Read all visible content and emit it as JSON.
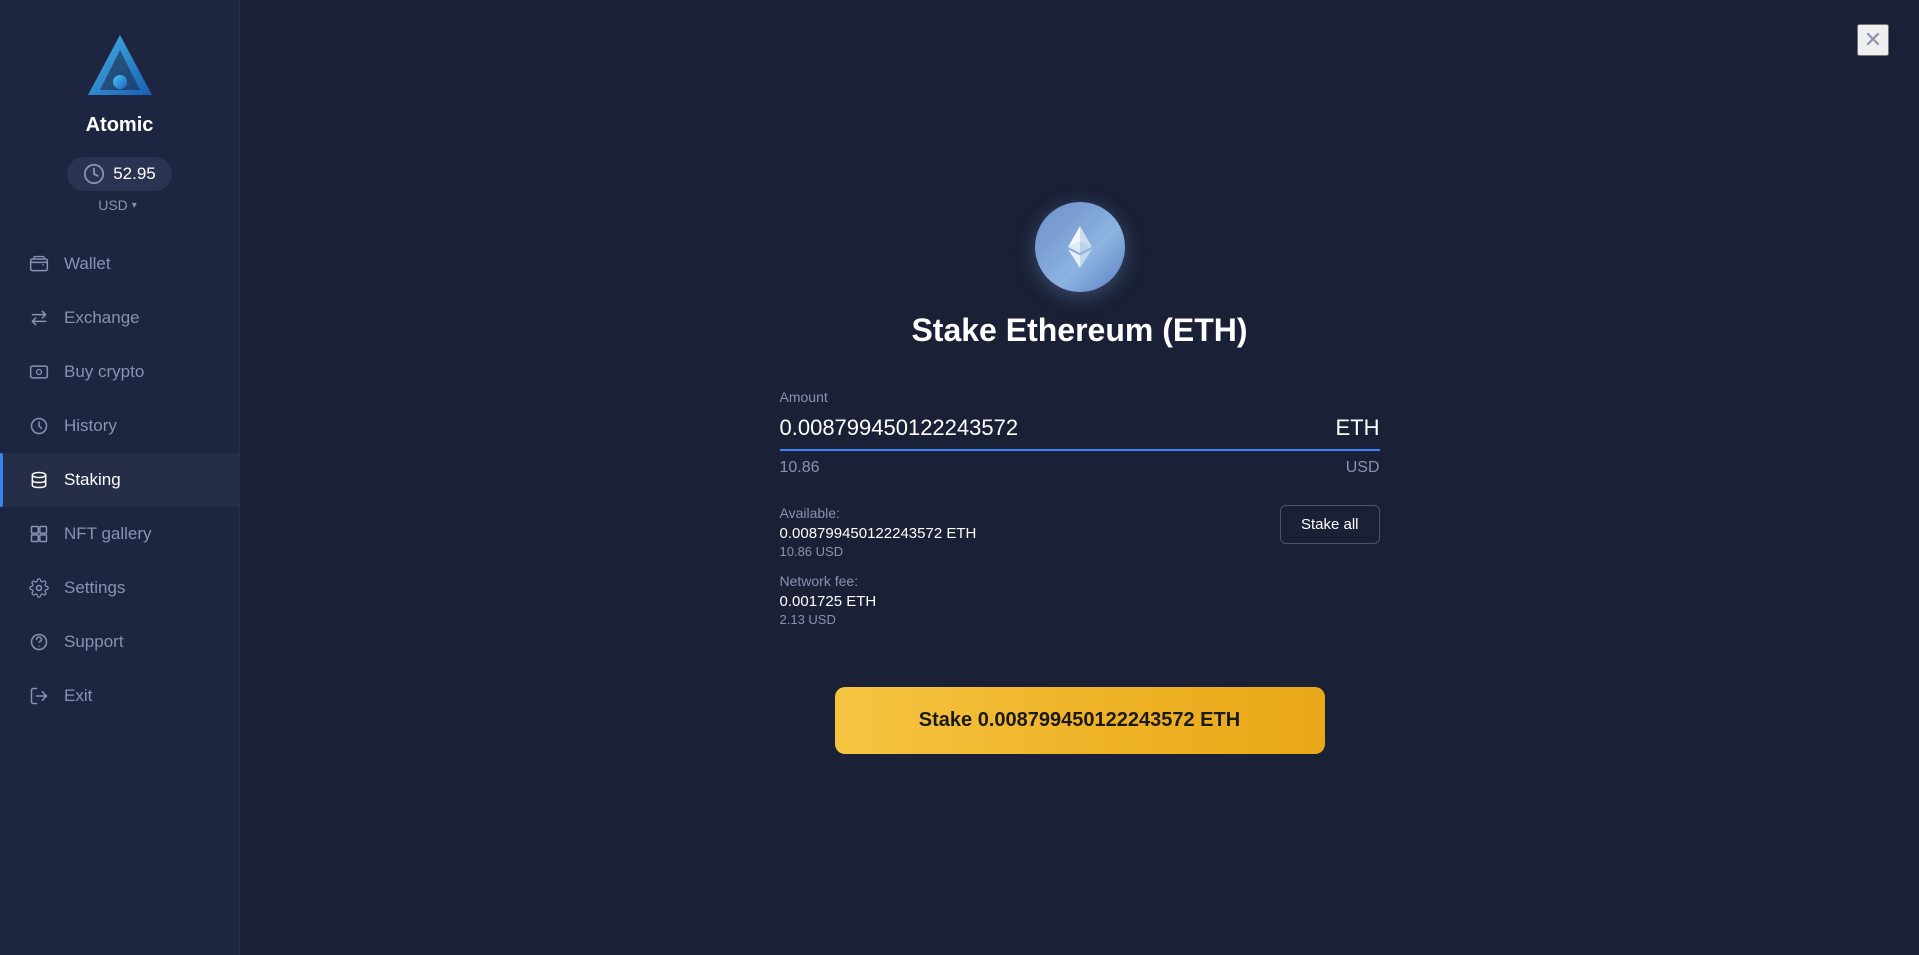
{
  "app": {
    "name": "Atomic",
    "balance": "52.95",
    "currency": "USD"
  },
  "sidebar": {
    "items": [
      {
        "id": "wallet",
        "label": "Wallet",
        "icon": "wallet-icon",
        "active": false
      },
      {
        "id": "exchange",
        "label": "Exchange",
        "icon": "exchange-icon",
        "active": false
      },
      {
        "id": "buy-crypto",
        "label": "Buy crypto",
        "icon": "buy-crypto-icon",
        "active": false
      },
      {
        "id": "history",
        "label": "History",
        "icon": "history-icon",
        "active": false
      },
      {
        "id": "staking",
        "label": "Staking",
        "icon": "staking-icon",
        "active": true
      },
      {
        "id": "nft-gallery",
        "label": "NFT gallery",
        "icon": "nft-gallery-icon",
        "active": false
      },
      {
        "id": "settings",
        "label": "Settings",
        "icon": "settings-icon",
        "active": false
      },
      {
        "id": "support",
        "label": "Support",
        "icon": "support-icon",
        "active": false
      },
      {
        "id": "exit",
        "label": "Exit",
        "icon": "exit-icon",
        "active": false
      }
    ]
  },
  "stake_modal": {
    "title": "Stake Ethereum (ETH)",
    "amount_label": "Amount",
    "amount_value": "0.008799450122243572",
    "amount_currency": "ETH",
    "amount_usd": "10.86",
    "amount_usd_currency": "USD",
    "available_label": "Available:",
    "available_eth": "0.008799450122243572 ETH",
    "available_usd": "10.86 USD",
    "stake_all_label": "Stake all",
    "network_fee_label": "Network fee:",
    "network_fee_eth": "0.001725 ETH",
    "network_fee_usd": "2.13 USD",
    "stake_button_label": "Stake 0.008799450122243572 ETH",
    "close_label": "✕"
  }
}
